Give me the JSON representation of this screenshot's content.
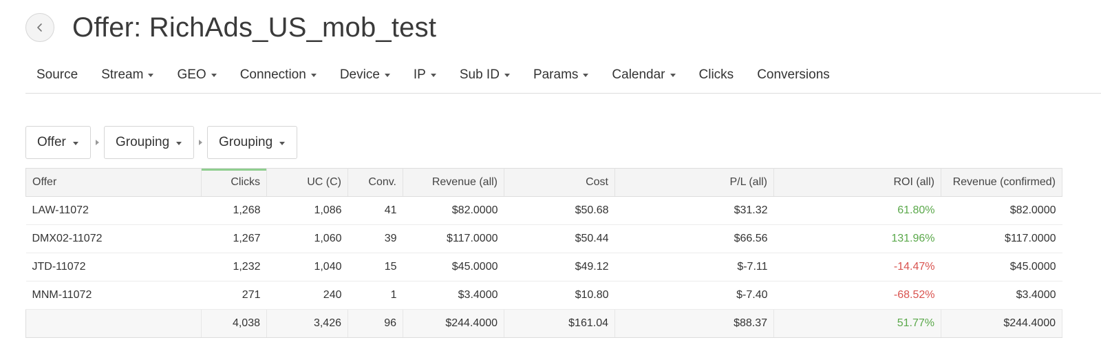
{
  "header": {
    "title": "Offer: RichAds_US_mob_test",
    "back_icon": "chevron-left-icon"
  },
  "nav": {
    "items": [
      {
        "label": "Source",
        "dropdown": false
      },
      {
        "label": "Stream",
        "dropdown": true
      },
      {
        "label": "GEO",
        "dropdown": true
      },
      {
        "label": "Connection",
        "dropdown": true
      },
      {
        "label": "Device",
        "dropdown": true
      },
      {
        "label": "IP",
        "dropdown": true
      },
      {
        "label": "Sub ID",
        "dropdown": true
      },
      {
        "label": "Params",
        "dropdown": true
      },
      {
        "label": "Calendar",
        "dropdown": true
      },
      {
        "label": "Clicks",
        "dropdown": false
      },
      {
        "label": "Conversions",
        "dropdown": false
      }
    ]
  },
  "grouping": {
    "buttons": [
      {
        "label": "Offer"
      },
      {
        "label": "Grouping"
      },
      {
        "label": "Grouping"
      }
    ]
  },
  "table": {
    "columns": [
      "Offer",
      "Clicks",
      "UC (C)",
      "Conv.",
      "Revenue (all)",
      "Cost",
      "P/L (all)",
      "ROI (all)",
      "Revenue (confirmed)"
    ],
    "sorted_column": "Clicks",
    "rows": [
      {
        "offer": "LAW-11072",
        "clicks": "1,268",
        "uc": "1,086",
        "conv": "41",
        "revenue_all": "$82.0000",
        "cost": "$50.68",
        "pl": "$31.32",
        "roi": "61.80%",
        "roi_status": "positive",
        "revenue_confirmed": "$82.0000"
      },
      {
        "offer": "DMX02-11072",
        "clicks": "1,267",
        "uc": "1,060",
        "conv": "39",
        "revenue_all": "$117.0000",
        "cost": "$50.44",
        "pl": "$66.56",
        "roi": "131.96%",
        "roi_status": "positive",
        "revenue_confirmed": "$117.0000"
      },
      {
        "offer": "JTD-11072",
        "clicks": "1,232",
        "uc": "1,040",
        "conv": "15",
        "revenue_all": "$45.0000",
        "cost": "$49.12",
        "pl": "$-7.11",
        "roi": "-14.47%",
        "roi_status": "negative",
        "revenue_confirmed": "$45.0000"
      },
      {
        "offer": "MNM-11072",
        "clicks": "271",
        "uc": "240",
        "conv": "1",
        "revenue_all": "$3.4000",
        "cost": "$10.80",
        "pl": "$-7.40",
        "roi": "-68.52%",
        "roi_status": "negative",
        "revenue_confirmed": "$3.4000"
      }
    ],
    "totals": {
      "offer": "",
      "clicks": "4,038",
      "uc": "3,426",
      "conv": "96",
      "revenue_all": "$244.4000",
      "cost": "$161.04",
      "pl": "$88.37",
      "roi": "51.77%",
      "roi_status": "positive",
      "revenue_confirmed": "$244.4000"
    }
  },
  "colors": {
    "positive": "#5aa84a",
    "negative": "#d9534f",
    "sort_indicator": "#8fce8f"
  }
}
